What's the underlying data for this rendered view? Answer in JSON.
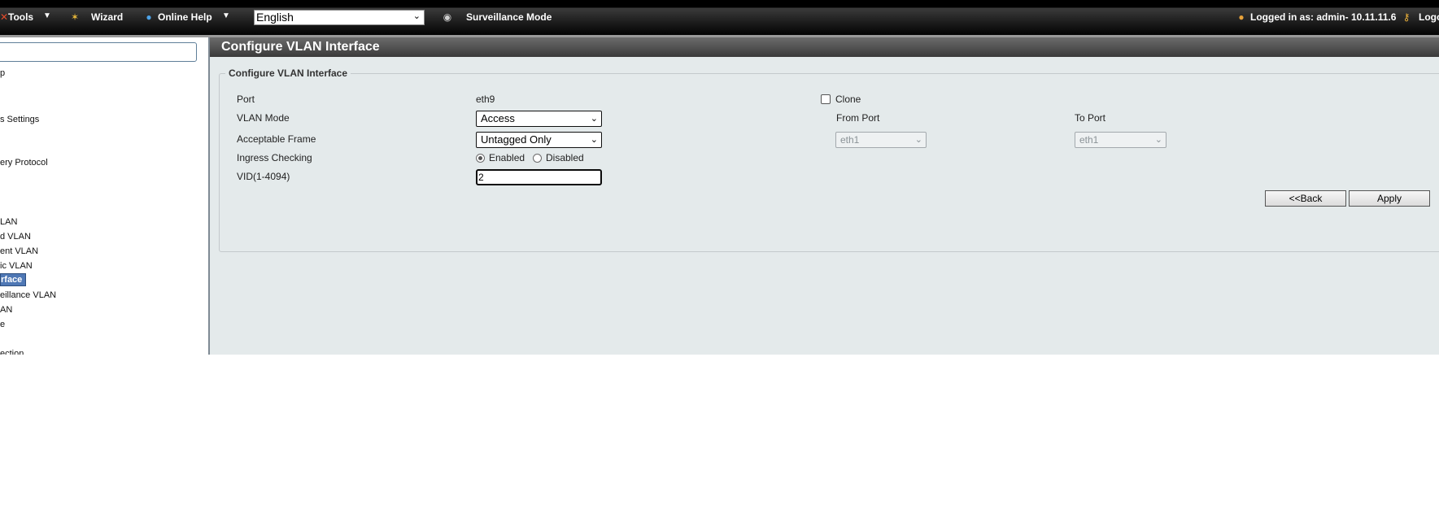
{
  "toolbar": {
    "tools_label": "Tools",
    "wizard_label": "Wizard",
    "online_help_label": "Online Help",
    "language_selected": "English",
    "surveillance_label": "Surveillance Mode",
    "logged_in_text": "Logged in as: admin- 10.11.11.6",
    "logout_label": "Logo"
  },
  "tree": {
    "items": [
      "p",
      "s Settings",
      "ery Protocol",
      "LAN",
      "d VLAN",
      "ent VLAN",
      "ic VLAN",
      "rface",
      "eillance VLAN",
      "AN",
      "e",
      "ection"
    ]
  },
  "panel": {
    "title": "Configure VLAN Interface",
    "legend": "Configure VLAN Interface",
    "port_label": "Port",
    "port_value": "eth9",
    "vlan_mode_label": "VLAN Mode",
    "vlan_mode_value": "Access",
    "acceptable_frame_label": "Acceptable Frame",
    "acceptable_frame_value": "Untagged Only",
    "ingress_label": "Ingress Checking",
    "ingress_enabled": "Enabled",
    "ingress_disabled": "Disabled",
    "vid_label": "VID(1-4094)",
    "vid_value": "2",
    "clone_label": "Clone",
    "from_port_label": "From Port",
    "from_port_value": "eth1",
    "to_port_label": "To Port",
    "to_port_value": "eth1",
    "back_label": "<<Back",
    "apply_label": "Apply"
  }
}
